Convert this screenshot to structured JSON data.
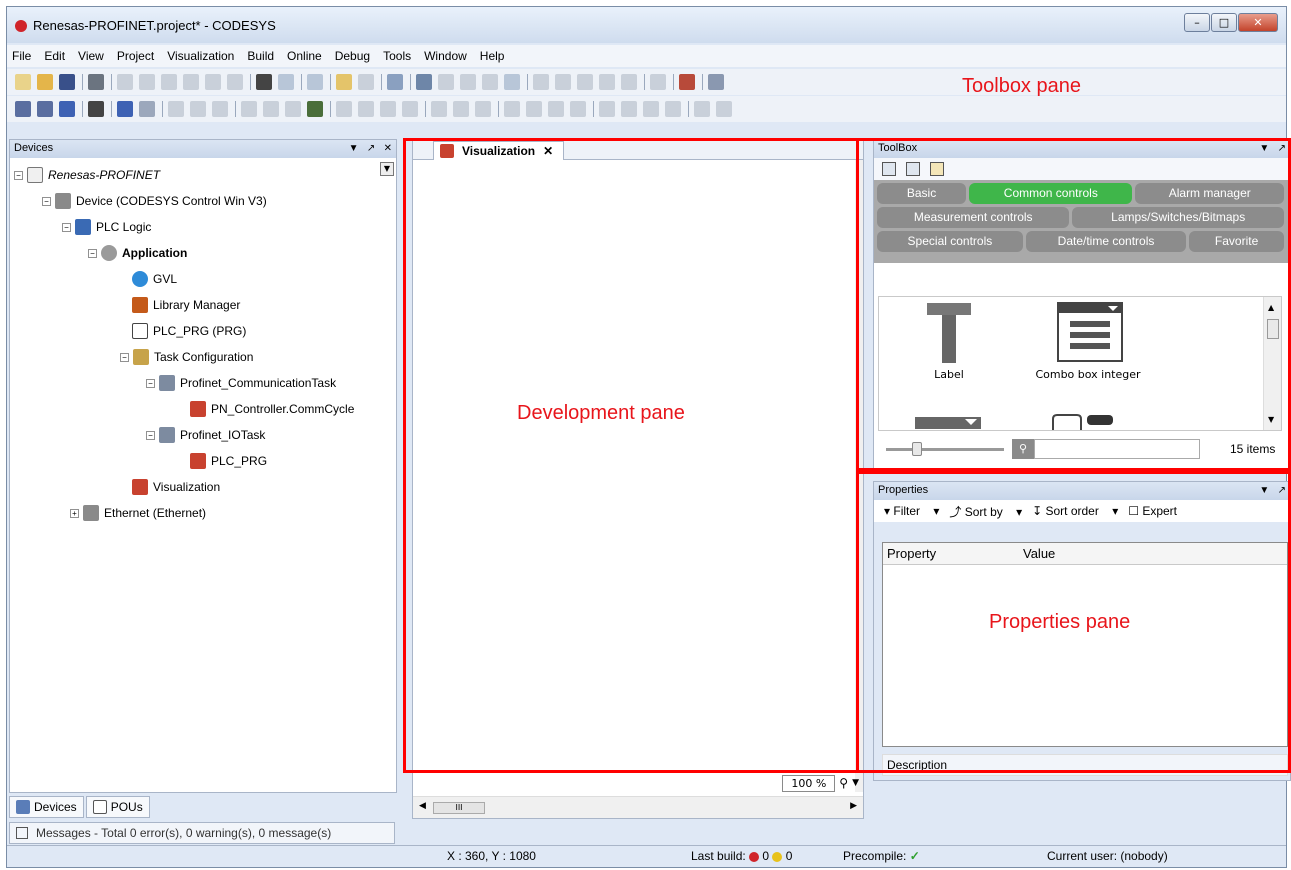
{
  "window": {
    "title": "Renesas-PROFINET.project* - CODESYS"
  },
  "menu": [
    "File",
    "Edit",
    "View",
    "Project",
    "Visualization",
    "Build",
    "Online",
    "Debug",
    "Tools",
    "Window",
    "Help"
  ],
  "annotations": {
    "toolbox": "Toolbox pane",
    "development": "Development pane",
    "properties": "Properties pane"
  },
  "devices": {
    "header": "Devices",
    "tree": [
      {
        "label": "Renesas-PROFINET",
        "italic": true
      },
      {
        "label": "Device (CODESYS Control Win V3)"
      },
      {
        "label": "PLC Logic"
      },
      {
        "label": "Application",
        "bold": true
      },
      {
        "label": "GVL"
      },
      {
        "label": "Library Manager"
      },
      {
        "label": "PLC_PRG (PRG)"
      },
      {
        "label": "Task Configuration"
      },
      {
        "label": "Profinet_CommunicationTask"
      },
      {
        "label": "PN_Controller.CommCycle"
      },
      {
        "label": "Profinet_IOTask"
      },
      {
        "label": "PLC_PRG"
      },
      {
        "label": "Visualization"
      },
      {
        "label": "Ethernet (Ethernet)"
      }
    ],
    "tabs": [
      "Devices",
      "POUs"
    ]
  },
  "messages": "Messages - Total 0 error(s), 0 warning(s), 0 message(s)",
  "editor": {
    "tab": "Visualization",
    "zoom": "100 %",
    "scroll_thumb": "III"
  },
  "toolbox": {
    "header": "ToolBox",
    "groups_row1": [
      "Basic",
      "Common controls",
      "Alarm manager"
    ],
    "groups_row2": [
      "Measurement controls",
      "Lamps/Switches/Bitmaps"
    ],
    "groups_row3": [
      "Special controls",
      "Date/time controls",
      "Favorite"
    ],
    "active_group": "Common controls",
    "items": [
      "Label",
      "Combo box integer"
    ],
    "count": "15 items"
  },
  "properties": {
    "header": "Properties",
    "filter": "Filter",
    "sort_by": "Sort by",
    "sort_order": "Sort order",
    "expert": "Expert",
    "col_property": "Property",
    "col_value": "Value",
    "description": "Description"
  },
  "status": {
    "coords": "X : 360, Y : 1080",
    "last_build": "Last build:",
    "errors": "0",
    "warnings": "0",
    "precompile": "Precompile:",
    "user": "Current user: (nobody)"
  }
}
